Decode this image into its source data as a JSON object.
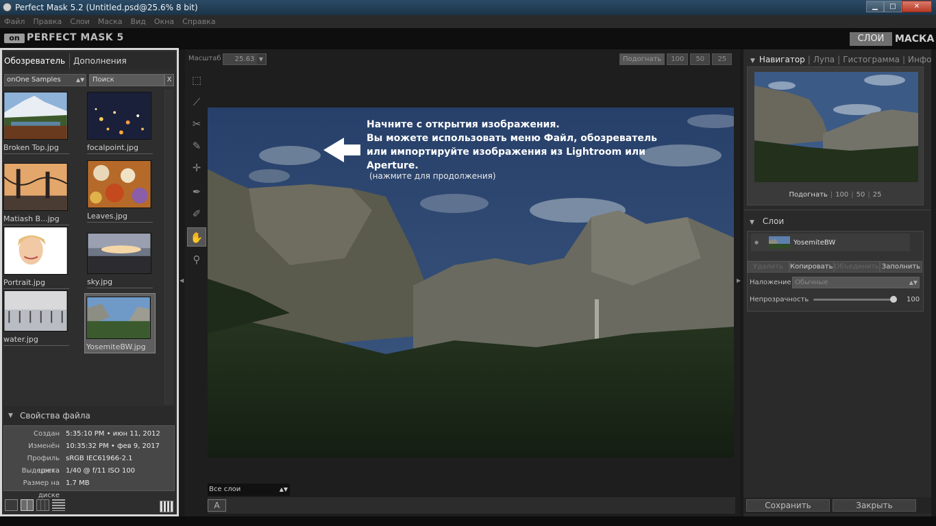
{
  "window": {
    "title": "Perfect Mask 5.2 (Untitled.psd@25.6% 8 bit)",
    "min": "▁",
    "max": "□",
    "close": "✕"
  },
  "menu": [
    "Файл",
    "Правка",
    "Слои",
    "Маска",
    "Вид",
    "Окна",
    "Справка"
  ],
  "brand": {
    "logo": "on",
    "name": "PERFECT MASK 5",
    "mode_layers": "СЛОИ",
    "mode_mask": "МАСКА"
  },
  "browser": {
    "tabs": [
      "Обозреватель",
      "Дополнения"
    ],
    "source": "onOne Samples",
    "search_placeholder": "Поиск",
    "search_clear": "X",
    "thumbs": [
      {
        "name": "Broken Top.jpg"
      },
      {
        "name": "focalpoint.jpg"
      },
      {
        "name": "Matiash B...jpg"
      },
      {
        "name": "Leaves.jpg"
      },
      {
        "name": "Portrait.jpg"
      },
      {
        "name": "sky.jpg"
      },
      {
        "name": "water.jpg"
      },
      {
        "name": "YosemiteBW.jpg",
        "selected": true
      }
    ]
  },
  "file_props": {
    "title": "Свойства файла",
    "rows": [
      {
        "k": "Создан",
        "v": "5:35:10 PM • июн 11, 2012"
      },
      {
        "k": "Изменён",
        "v": "10:35:32 PM • фев 9, 2017"
      },
      {
        "k": "Профиль цвета",
        "v": "sRGB IEC61966-2.1"
      },
      {
        "k": "Выдержка",
        "v": "1/40 @ f/11 ISO 100"
      },
      {
        "k": "Размер на диске",
        "v": "1.7 MB"
      }
    ]
  },
  "canvas": {
    "zoom_label": "Масштаб",
    "zoom_value": "25.63",
    "zoom_buttons": [
      "Подогнать",
      "100",
      "50",
      "25"
    ],
    "message_lines": [
      "Начните с открытия изображения.",
      "Вы можете использовать меню Файл, обозреватель",
      "или импортируйте изображения из Lightroom или",
      "Aperture."
    ],
    "message_sub": "(нажмите для продолжения)",
    "layer_select": "Все слои",
    "a_button": "A"
  },
  "tools": [
    "marquee-tool-icon",
    "brush-line-tool-icon",
    "scissors-tool-icon",
    "color-picker-brush-icon",
    "crosshair-tool-icon",
    "pen-dropper-icon",
    "chisel-brush-icon",
    "hand-tool-icon",
    "zoom-tool-icon"
  ],
  "navigator": {
    "tabs": [
      "Навигатор",
      "Лупа",
      "Гистограмма",
      "Инфо"
    ],
    "zoom_buttons": [
      "Подогнать",
      "100",
      "50",
      "25"
    ]
  },
  "layers": {
    "title": "Слои",
    "layer_name": "YosemiteBW",
    "buttons": [
      "Удалить",
      "Копировать",
      "Объединить",
      "Заполнить"
    ],
    "blend_label": "Наложение",
    "blend_value": "Обычные",
    "opacity_label": "Непрозрачность",
    "opacity_value": "100",
    "opacity_fraction": 1.0
  },
  "footer": {
    "save": "Сохранить",
    "close": "Закрыть"
  }
}
